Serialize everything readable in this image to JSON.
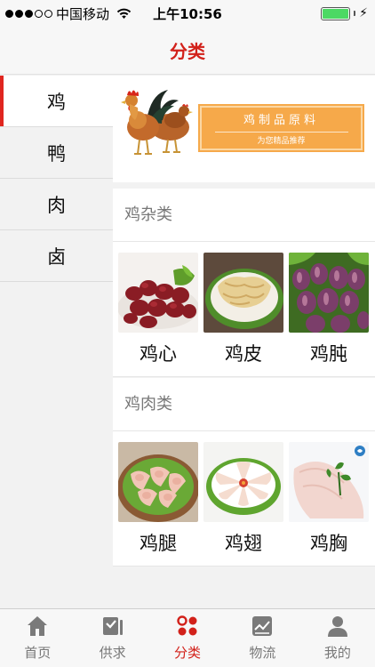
{
  "status": {
    "carrier": "中国移动",
    "time": "上午10:56",
    "signal_bars": 3,
    "battery_level": 1.0
  },
  "header": {
    "title": "分类"
  },
  "sidebar": {
    "items": [
      {
        "label": "鸡",
        "active": true
      },
      {
        "label": "鸭",
        "active": false
      },
      {
        "label": "肉",
        "active": false
      },
      {
        "label": "卤",
        "active": false
      }
    ]
  },
  "banner": {
    "title": "鸡制品原料",
    "subtitle": "为您精品推荐"
  },
  "sections": [
    {
      "title": "鸡杂类",
      "items": [
        {
          "label": "鸡心",
          "image": "chicken-heart"
        },
        {
          "label": "鸡皮",
          "image": "chicken-skin"
        },
        {
          "label": "鸡肫",
          "image": "chicken-gizzard"
        }
      ]
    },
    {
      "title": "鸡肉类",
      "items": [
        {
          "label": "鸡腿",
          "image": "chicken-leg"
        },
        {
          "label": "鸡翅",
          "image": "chicken-wing"
        },
        {
          "label": "鸡胸",
          "image": "chicken-breast"
        }
      ]
    }
  ],
  "tabs": [
    {
      "label": "首页",
      "icon": "home-icon",
      "active": false
    },
    {
      "label": "供求",
      "icon": "supply-icon",
      "active": false
    },
    {
      "label": "分类",
      "icon": "category-icon",
      "active": true
    },
    {
      "label": "物流",
      "icon": "logistics-icon",
      "active": false
    },
    {
      "label": "我的",
      "icon": "profile-icon",
      "active": false
    }
  ],
  "colors": {
    "accent": "#d2211a",
    "banner": "#f6a94a",
    "battery": "#4cd964"
  }
}
